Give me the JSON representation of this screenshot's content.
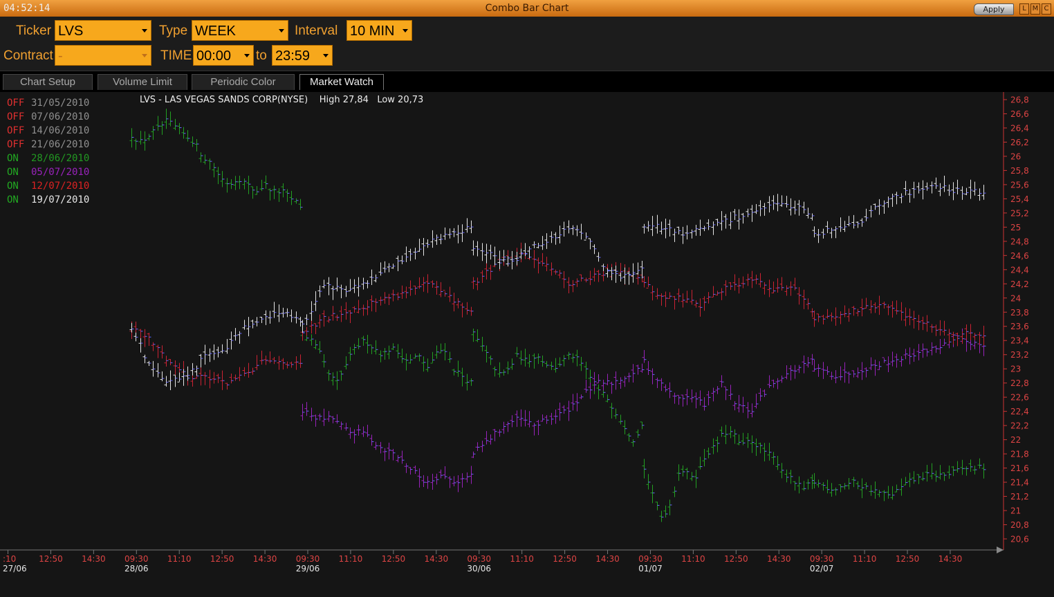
{
  "window": {
    "clock": "04:52:14",
    "title": "Combo Bar Chart",
    "apply_label": "Apply",
    "buttons": [
      "L",
      "M",
      "C"
    ]
  },
  "params": {
    "ticker_label": "Ticker",
    "ticker_value": "LVS",
    "type_label": "Type",
    "type_value": "WEEK",
    "interval_label": "Interval",
    "interval_value": "10 MIN",
    "contract_label": "Contract",
    "contract_value": "-",
    "time_label": "TIME",
    "time_from": "00:00",
    "to_label": "to",
    "time_to": "23:59"
  },
  "tabs": [
    {
      "label": "Chart Setup",
      "active": false
    },
    {
      "label": "Volume Limit",
      "active": false
    },
    {
      "label": "Periodic Color",
      "active": false
    },
    {
      "label": "Market Watch",
      "active": true
    }
  ],
  "chart_header": {
    "title": "LVS - LAS VEGAS SANDS CORP(NYSE)",
    "high": "High 27,84",
    "low": "Low 20,73"
  },
  "chart_data": {
    "type": "bar",
    "style": "ohlc-overlay",
    "legend_placement": "top-left",
    "grid": false,
    "ylim": [
      20.6,
      26.8
    ],
    "y_ticks": [
      "26,8",
      "26,6",
      "26,4",
      "26,2",
      "26",
      "25,8",
      "25,6",
      "25,4",
      "25,2",
      "25",
      "24,8",
      "24,6",
      "24,4",
      "24,2",
      "24",
      "23,8",
      "23,6",
      "23,4",
      "23,2",
      "23",
      "22,8",
      "22,6",
      "22,4",
      "22,2",
      "22",
      "21,8",
      "21,6",
      "21,4",
      "21,2",
      "21",
      "20,8",
      "20,6"
    ],
    "x_ticks": [
      {
        "time": ":10",
        "date": "27/06"
      },
      {
        "time": "12:50",
        "date": ""
      },
      {
        "time": "14:30",
        "date": ""
      },
      {
        "time": "09:30",
        "date": "28/06"
      },
      {
        "time": "11:10",
        "date": ""
      },
      {
        "time": "12:50",
        "date": ""
      },
      {
        "time": "14:30",
        "date": ""
      },
      {
        "time": "09:30",
        "date": "29/06"
      },
      {
        "time": "11:10",
        "date": ""
      },
      {
        "time": "12:50",
        "date": ""
      },
      {
        "time": "14:30",
        "date": ""
      },
      {
        "time": "09:30",
        "date": "30/06"
      },
      {
        "time": "11:10",
        "date": ""
      },
      {
        "time": "12:50",
        "date": ""
      },
      {
        "time": "14:30",
        "date": ""
      },
      {
        "time": "09:30",
        "date": "01/07"
      },
      {
        "time": "11:10",
        "date": ""
      },
      {
        "time": "12:50",
        "date": ""
      },
      {
        "time": "14:30",
        "date": ""
      },
      {
        "time": "09:30",
        "date": "02/07"
      },
      {
        "time": "11:10",
        "date": ""
      },
      {
        "time": "12:50",
        "date": ""
      },
      {
        "time": "14:30",
        "date": ""
      }
    ],
    "legend": [
      {
        "state": "OFF",
        "date": "31/05/2010",
        "state_color": "#e03030",
        "date_color": "#909090"
      },
      {
        "state": "OFF",
        "date": "07/06/2010",
        "state_color": "#e03030",
        "date_color": "#909090"
      },
      {
        "state": "OFF",
        "date": "14/06/2010",
        "state_color": "#e03030",
        "date_color": "#909090"
      },
      {
        "state": "OFF",
        "date": "21/06/2010",
        "state_color": "#e03030",
        "date_color": "#909090"
      },
      {
        "state": "ON",
        "date": "28/06/2010",
        "state_color": "#22aa22",
        "date_color": "#229922"
      },
      {
        "state": "ON",
        "date": "05/07/2010",
        "state_color": "#22aa22",
        "date_color": "#9922bb"
      },
      {
        "state": "ON",
        "date": "12/07/2010",
        "state_color": "#22aa22",
        "date_color": "#dd2222"
      },
      {
        "state": "ON",
        "date": "19/07/2010",
        "state_color": "#22aa22",
        "date_color": "#e6e6e6"
      }
    ],
    "series": [
      {
        "name": "28/06/2010",
        "color": "#22a022",
        "values": [
          {
            "slot": 0,
            "v": [
              26.3,
              26.2,
              26.3,
              26.4,
              26.5,
              26.4,
              26.3,
              26.2,
              26.0,
              25.9,
              25.7,
              25.6,
              25.7,
              25.6,
              25.5,
              25.6,
              25.5,
              25.5,
              25.4,
              25.3
            ]
          },
          {
            "slot": 1,
            "v": [
              23.5,
              23.4,
              23.2,
              22.9,
              22.8,
              23.1,
              23.3,
              23.4,
              23.3,
              23.2,
              23.3,
              23.2,
              23.1,
              23.2,
              23.0,
              23.2,
              23.3,
              23.0,
              22.9,
              22.8
            ]
          },
          {
            "slot": 2,
            "v": [
              23.5,
              23.3,
              23.1,
              22.9,
              23.0,
              23.2,
              23.1,
              23.2,
              23.1,
              23.0,
              23.1,
              23.2,
              23.1,
              22.9,
              22.7,
              22.6,
              22.4,
              22.2,
              22.0,
              22.2
            ]
          },
          {
            "slot": 3,
            "v": [
              21.6,
              21.2,
              20.9,
              21.1,
              21.6,
              21.5,
              21.5,
              21.8,
              21.9,
              22.1,
              22.1,
              21.9,
              22.0,
              21.9,
              21.8,
              21.7,
              21.5,
              21.4,
              21.3,
              21.4
            ]
          },
          {
            "slot": 4,
            "v": [
              21.4,
              21.3,
              21.4,
              21.3,
              21.2,
              21.4,
              21.5,
              21.5,
              21.6,
              21.6
            ]
          }
        ]
      },
      {
        "name": "05/07/2010",
        "color": "#9922bb",
        "values": [
          {
            "slot": 1,
            "v": [
              22.4,
              22.3,
              22.3,
              22.1,
              22.1,
              21.9,
              21.8,
              21.6,
              21.4,
              21.5,
              21.4,
              21.5
            ]
          },
          {
            "slot": 2,
            "v": [
              21.8,
              22.0,
              22.2,
              22.3,
              22.2,
              22.3,
              22.4,
              22.6,
              22.8,
              22.8,
              22.9,
              23.0
            ]
          },
          {
            "slot": 3,
            "v": [
              23.1,
              22.8,
              22.6,
              22.6,
              22.5,
              22.8,
              22.5,
              22.4,
              22.7,
              22.9,
              23.0,
              23.1
            ]
          },
          {
            "slot": 4,
            "v": [
              23.0,
              22.9,
              23.0,
              23.1,
              23.2,
              23.3,
              23.4,
              23.35
            ]
          }
        ]
      },
      {
        "name": "12/07/2010",
        "color": "#cc2233",
        "values": [
          {
            "slot": 0,
            "v": [
              23.6,
              23.4,
              23.1,
              22.9,
              22.9,
              22.8,
              22.9,
              23.1,
              23.1,
              23.05
            ]
          },
          {
            "slot": 1,
            "v": [
              23.5,
              23.7,
              23.8,
              23.9,
              24.0,
              24.1,
              24.2,
              24.0,
              23.8
            ]
          },
          {
            "slot": 2,
            "v": [
              24.2,
              24.5,
              24.6,
              24.5,
              24.2,
              24.3,
              24.4,
              24.3
            ]
          },
          {
            "slot": 3,
            "v": [
              24.2,
              24.0,
              24.0,
              23.9,
              24.1,
              24.2,
              24.3,
              24.1,
              24.2,
              23.8
            ]
          },
          {
            "slot": 4,
            "v": [
              23.7,
              23.8,
              23.9,
              23.7,
              23.5,
              23.5
            ]
          }
        ]
      },
      {
        "name": "19/07/2010",
        "color": "#e6e6e6",
        "values": [
          {
            "slot": 0,
            "v": [
              23.6,
              23.0,
              22.8,
              22.9,
              23.2,
              23.3,
              23.6,
              23.7,
              23.8,
              23.7
            ]
          },
          {
            "slot": 1,
            "v": [
              23.6,
              24.2,
              24.1,
              24.2,
              24.4,
              24.6,
              24.8,
              24.9,
              25.0
            ]
          },
          {
            "slot": 2,
            "v": [
              24.7,
              24.6,
              24.5,
              24.7,
              24.8,
              25.0,
              24.9,
              24.4,
              24.3,
              24.4
            ]
          },
          {
            "slot": 3,
            "v": [
              25.0,
              25.0,
              24.9,
              25.0,
              25.1,
              25.2,
              25.3,
              25.3,
              25.2
            ]
          },
          {
            "slot": 4,
            "v": [
              24.9,
              25.0,
              25.1,
              25.4,
              25.5,
              25.6,
              25.5,
              25.5
            ]
          }
        ]
      }
    ]
  }
}
